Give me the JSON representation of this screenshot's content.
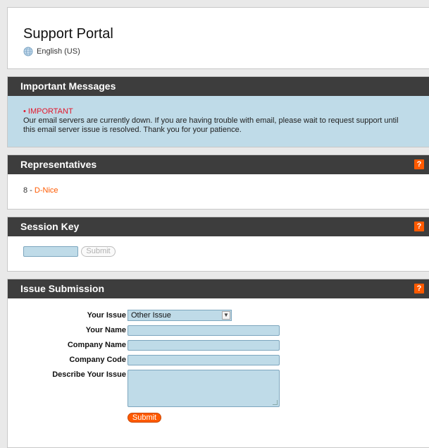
{
  "header": {
    "title": "Support Portal",
    "language": "English (US)"
  },
  "important": {
    "heading": "Important Messages",
    "tag": "IMPORTANT",
    "message": "Our email servers are currently down. If you are having trouble with email, please wait to request support until this email server issue is resolved. Thank you for your patience."
  },
  "representatives": {
    "heading": "Representatives",
    "help": "?",
    "count": "8",
    "separator": " - ",
    "name": "D-Nice"
  },
  "session_key": {
    "heading": "Session Key",
    "help": "?",
    "input_value": "",
    "submit_label": "Submit"
  },
  "issue": {
    "heading": "Issue Submission",
    "help": "?",
    "labels": {
      "issue": "Your Issue",
      "name": "Your Name",
      "company": "Company Name",
      "code": "Company Code",
      "describe": "Describe Your Issue"
    },
    "selected_issue": "Other Issue",
    "submit_label": "Submit"
  },
  "colors": {
    "accent": "#ff5a00",
    "bar": "#3d3d3d",
    "field": "#bfdbe8",
    "alert": "#e3172b"
  }
}
